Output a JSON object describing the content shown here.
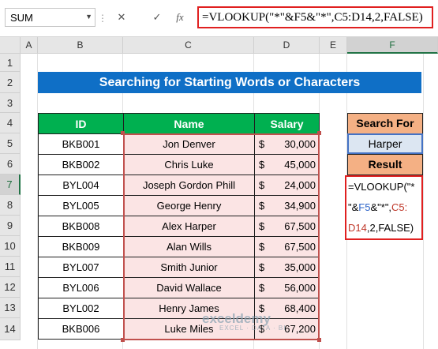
{
  "formula_bar": {
    "name_box": "SUM",
    "cancel_icon": "✕",
    "enter_icon": "✓",
    "fx_label": "fx",
    "formula": "=VLOOKUP(\"*\"&F5&\"*\",C5:D14,2,FALSE)"
  },
  "columns": [
    "A",
    "B",
    "C",
    "D",
    "E",
    "F"
  ],
  "rows": [
    "1",
    "2",
    "3",
    "4",
    "5",
    "6",
    "7",
    "8",
    "9",
    "10",
    "11",
    "12",
    "13",
    "14"
  ],
  "sheet": {
    "title": "Searching for Starting Words or Characters",
    "headers": {
      "id": "ID",
      "name": "Name",
      "salary": "Salary"
    },
    "currency": "$",
    "records": [
      {
        "id": "BKB001",
        "name": "Jon Denver",
        "salary": "30,000"
      },
      {
        "id": "BKB002",
        "name": "Chris Luke",
        "salary": "45,000"
      },
      {
        "id": "BYL004",
        "name": "Joseph Gordon Phill",
        "salary": "24,000"
      },
      {
        "id": "BYL005",
        "name": "George Henry",
        "salary": "34,900"
      },
      {
        "id": "BKB008",
        "name": "Alex Harper",
        "salary": "67,500"
      },
      {
        "id": "BKB009",
        "name": "Alan Wills",
        "salary": "67,500"
      },
      {
        "id": "BYL007",
        "name": "Smith Junior",
        "salary": "35,000"
      },
      {
        "id": "BYL006",
        "name": "David Wallace",
        "salary": "56,000"
      },
      {
        "id": "BYL002",
        "name": "Henry James",
        "salary": "68,400"
      },
      {
        "id": "BKB006",
        "name": "Luke Miles",
        "salary": "67,200"
      }
    ],
    "search_for_label": "Search For",
    "search_value": "Harper",
    "result_label": "Result",
    "edit_formula": {
      "line1": "=VLOOKUP(\"*",
      "line2_pre": "\"&",
      "line2_ref": "F5",
      "line2_mid": "&\"*\",",
      "line2_ref2": "C5:",
      "line3_ref": "D14",
      "line3_post": ",2,FALSE)"
    }
  },
  "watermark": {
    "brand": "exceldemy",
    "tagline": "EXCEL · DATA · BI"
  },
  "colors": {
    "title_bg": "#0f6fc6",
    "header_bg": "#00b050",
    "label_bg": "#f4b084",
    "highlight": "#e02020"
  }
}
